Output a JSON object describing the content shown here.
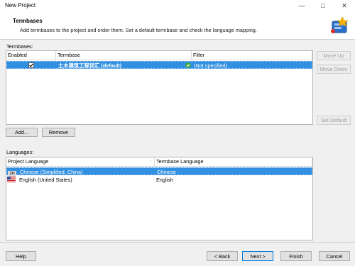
{
  "window": {
    "title": "New Project",
    "minimize_icon": "minimize-icon",
    "maximize_icon": "maximize-icon",
    "close_icon": "close-icon"
  },
  "header": {
    "title": "Termbases",
    "description": "Add termbases to the project and order them. Set a default termbase and check the language mapping."
  },
  "termbases": {
    "section_label": "Termbases:",
    "columns": {
      "enabled": "Enabled",
      "termbase": "Termbase",
      "filter": "Filter"
    },
    "rows": [
      {
        "enabled": true,
        "termbase": "土木建筑工程词汇 (default)",
        "status_icon": "check-circle-icon",
        "filter": "(Not specified)"
      }
    ],
    "buttons": {
      "move_up": "Move Up",
      "move_down": "Move Down",
      "set_default": "Set Default",
      "add": "Add...",
      "remove": "Remove"
    }
  },
  "languages": {
    "section_label": "Languages:",
    "columns": {
      "project_language": "Project Language",
      "termbase_language": "Termbase Language"
    },
    "rows": [
      {
        "flag": "zh-flag-icon",
        "flag_text": "ZH",
        "project_language": "Chinese (Simplified, China)",
        "termbase_language": "Chinese"
      },
      {
        "flag": "us-flag-icon",
        "flag_text": "",
        "project_language": "English (United States)",
        "termbase_language": "English"
      }
    ]
  },
  "footer": {
    "help": "Help",
    "back": "< Back",
    "next": "Next >",
    "finish": "Finish",
    "cancel": "Cancel"
  },
  "colors": {
    "selection": "#3390e0",
    "accent": "#0078d7"
  }
}
